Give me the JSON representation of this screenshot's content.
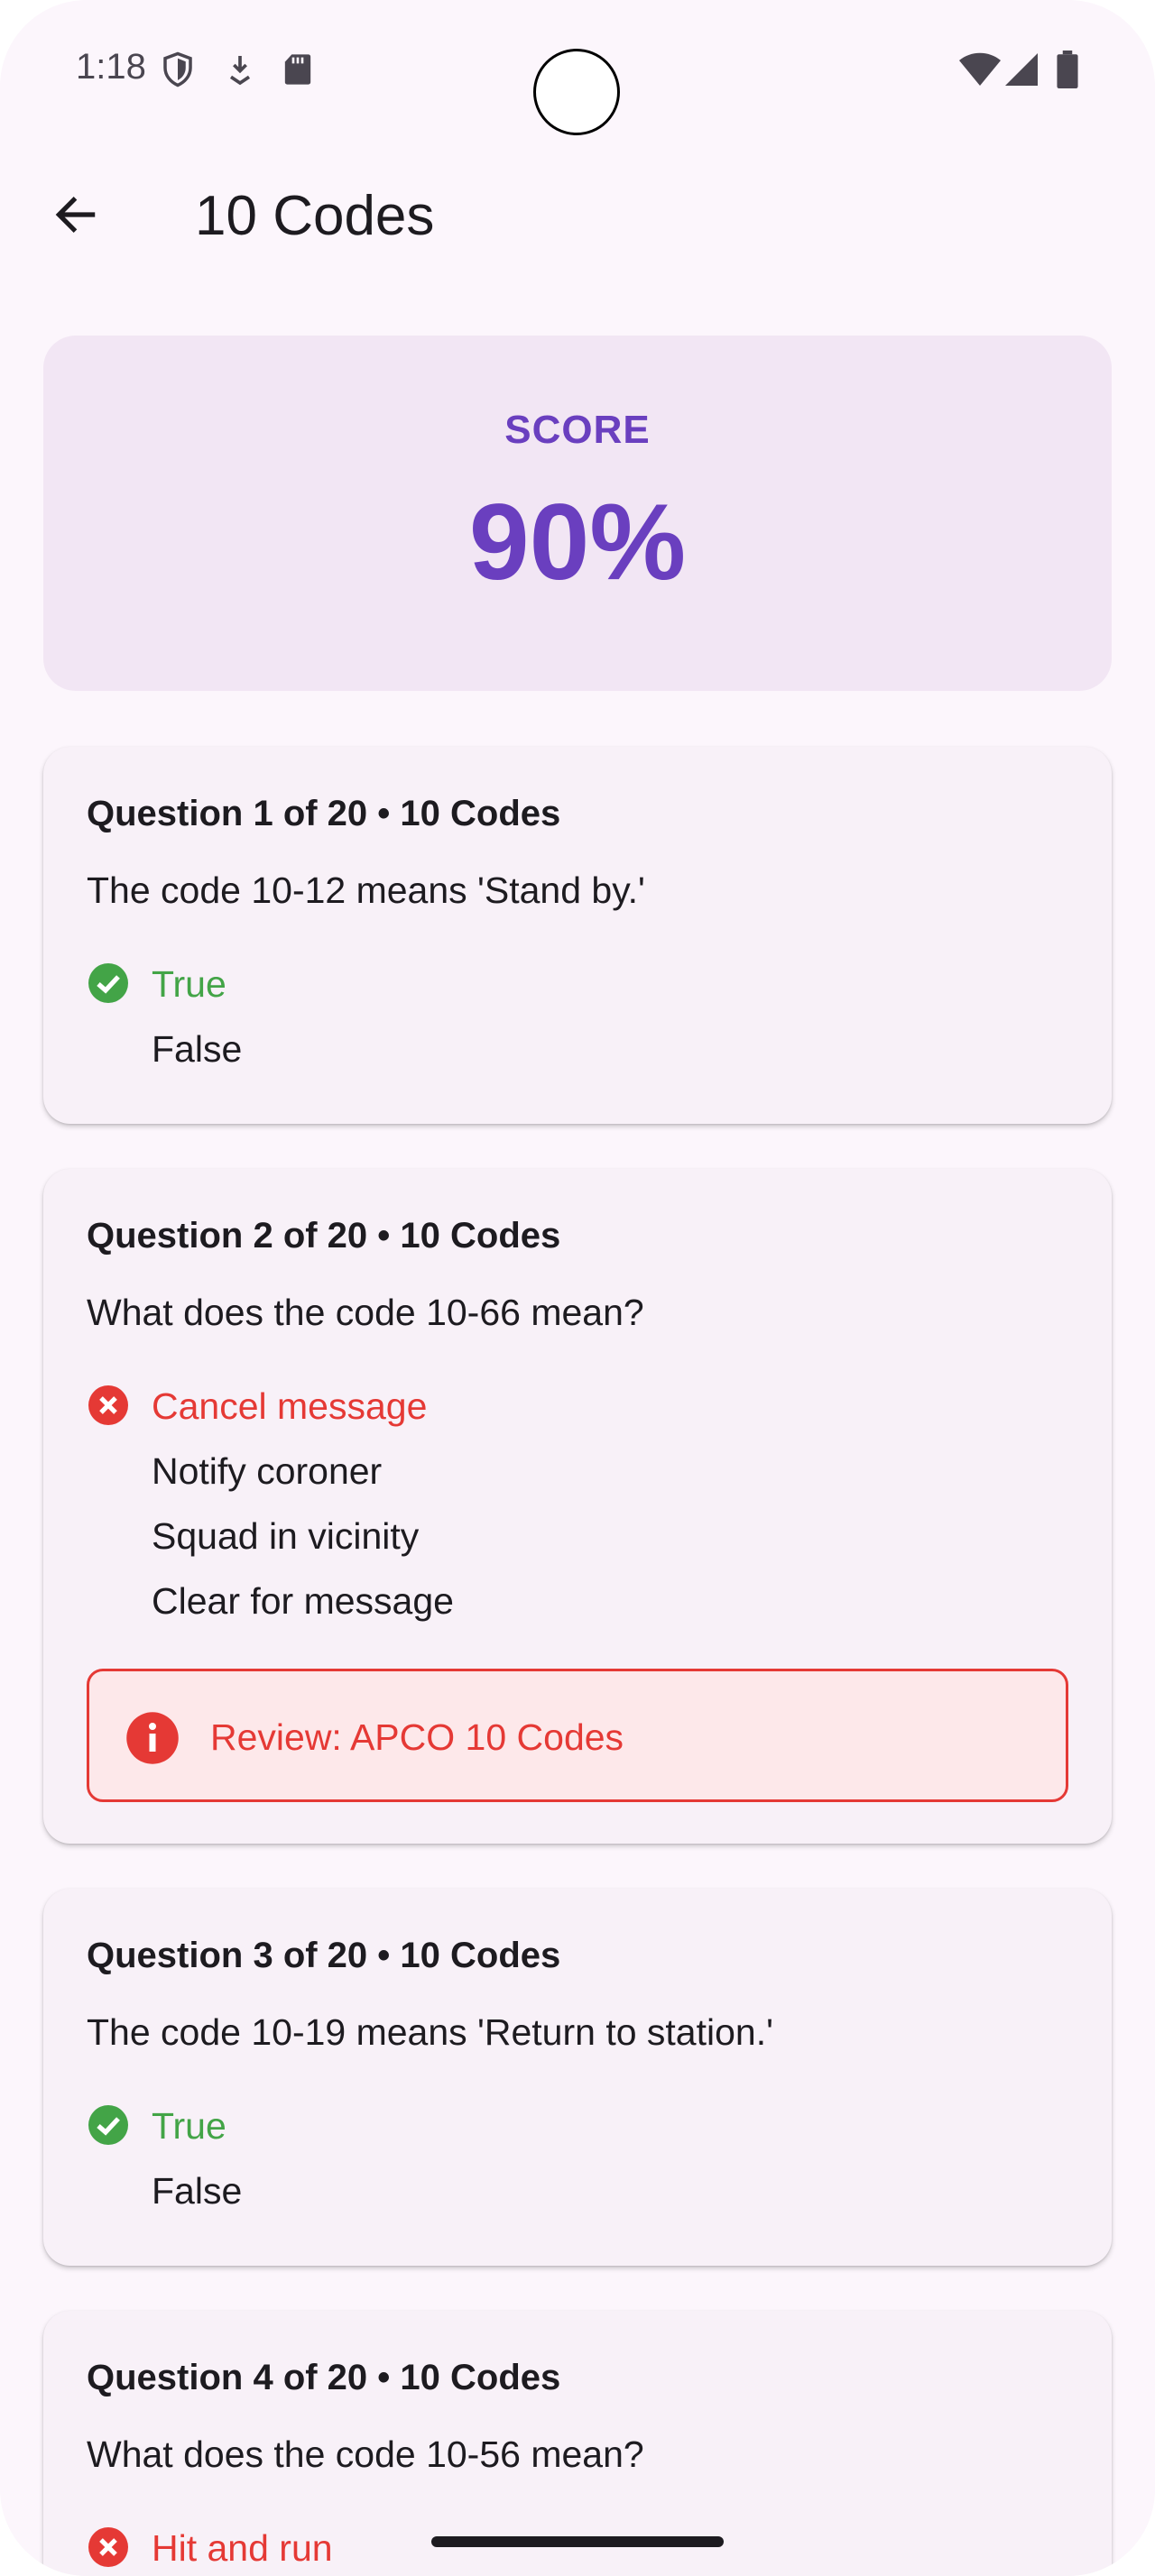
{
  "status_bar": {
    "time": "1:18",
    "icons": [
      "shield-icon",
      "download-icon",
      "sd-card-icon",
      "wifi-icon",
      "signal-icon",
      "battery-icon"
    ]
  },
  "app_bar": {
    "title": "10 Codes",
    "back_icon": "arrow-back-icon"
  },
  "score": {
    "label": "SCORE",
    "value": "90%"
  },
  "colors": {
    "accent": "#6a3fbf",
    "correct": "#43a447",
    "wrong": "#e53935",
    "card": "#f8f1f8"
  },
  "questions": [
    {
      "header": "Question 1 of 20 • 10 Codes",
      "text": "The code 10-12 means 'Stand by.'",
      "options": [
        {
          "label": "True",
          "state": "correct"
        },
        {
          "label": "False",
          "state": "none"
        }
      ]
    },
    {
      "header": "Question 2 of 20 • 10 Codes",
      "text": "What does the code 10-66 mean?",
      "options": [
        {
          "label": "Cancel message",
          "state": "wrong"
        },
        {
          "label": "Notify coroner",
          "state": "none"
        },
        {
          "label": "Squad in vicinity",
          "state": "none"
        },
        {
          "label": "Clear for message",
          "state": "none"
        }
      ],
      "review": "Review: APCO 10 Codes"
    },
    {
      "header": "Question 3 of 20 • 10 Codes",
      "text": "The code 10-19 means 'Return to station.'",
      "options": [
        {
          "label": "True",
          "state": "correct"
        },
        {
          "label": "False",
          "state": "none"
        }
      ]
    },
    {
      "header": "Question 4 of 20 • 10 Codes",
      "text": "What does the code 10-56 mean?",
      "options": [
        {
          "label": "Hit and run",
          "state": "wrong"
        }
      ]
    }
  ]
}
